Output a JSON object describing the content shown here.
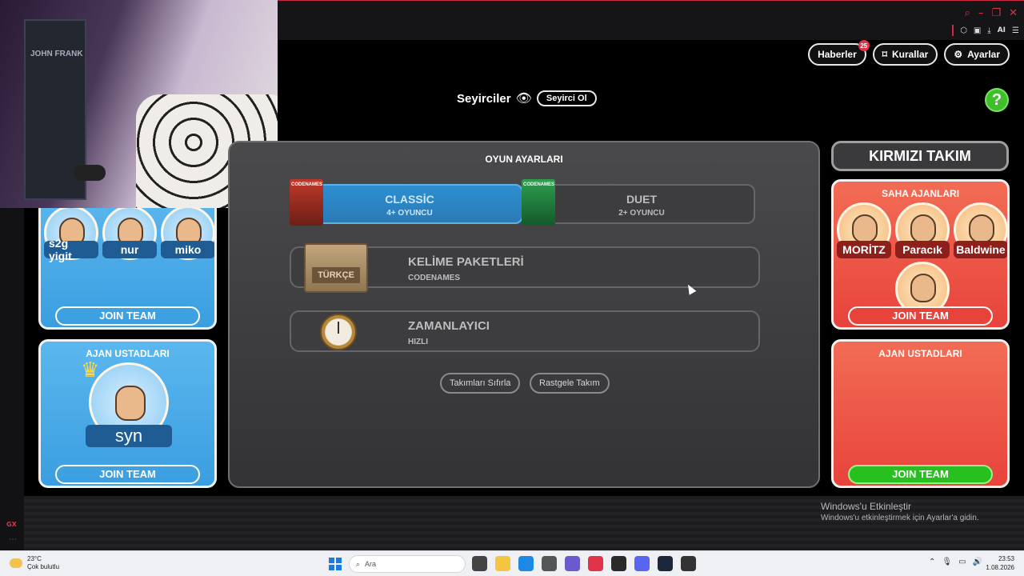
{
  "top_buttons": {
    "news": "Haberler",
    "news_badge": "25",
    "rules": "Kurallar",
    "settings": "Ayarlar"
  },
  "help_label": "?",
  "spectators": {
    "title": "Seyirciler",
    "button": "Seyirci Ol"
  },
  "webcam": {
    "poster_text": "JOHN FRANK"
  },
  "blue_team": {
    "operatives": [
      "s2g yigit",
      "nur",
      "miko"
    ],
    "join_label": "JOIN TEAM",
    "spymasters_title": "AJAN USTADLARI",
    "spymaster": "syn",
    "spymaster_join": "JOIN TEAM"
  },
  "red_team": {
    "title": "KIRMIZI TAKIM",
    "operatives_title": "SAHA AJANLARI",
    "operatives": [
      "MORİTZ",
      "Paracık",
      "Baldwine"
    ],
    "join_label": "JOIN TEAM",
    "spymasters_title": "AJAN USTADLARI",
    "spymaster_join": "JOIN TEAM"
  },
  "settings": {
    "title": "OYUN AYARLARI",
    "modes": [
      {
        "name": "CLASSİC",
        "sub": "4+ OYUNCU",
        "box": "CODENAMES"
      },
      {
        "name": "DUET",
        "sub": "2+ OYUNCU",
        "box": "CODENAMES"
      }
    ],
    "word_packs": {
      "title": "KELİME PAKETLERİ",
      "sub": "CODENAMES",
      "crate": "TÜRKÇE"
    },
    "timer": {
      "title": "ZAMANLAYICI",
      "sub": "HIZLI"
    },
    "reset_teams": "Takımları Sıfırla",
    "random_teams": "Rastgele Takım"
  },
  "watermark": {
    "line1": "Windows'u Etkinleştir",
    "line2": "Windows'u etkinleştirmek için Ayarlar'a gidin."
  },
  "browser": {
    "ai_label": "AI",
    "gx_label": "GX"
  },
  "taskbar": {
    "temp": "23°C",
    "weather": "Çok bulutlu",
    "search_placeholder": "Ara",
    "time": "23:53",
    "date": "1.08.2026",
    "icon_colors": [
      "#f4c542",
      "#1e88e5",
      "#555555",
      "#6a5acd",
      "#e0334a",
      "#2a2a2a",
      "#5865f2",
      "#1b2838",
      "#333333"
    ]
  },
  "colors": {
    "accent_red": "#ce2a45",
    "blue_team": "#3a9ee0",
    "red_team": "#e8433b",
    "join_green": "#27c01f"
  }
}
